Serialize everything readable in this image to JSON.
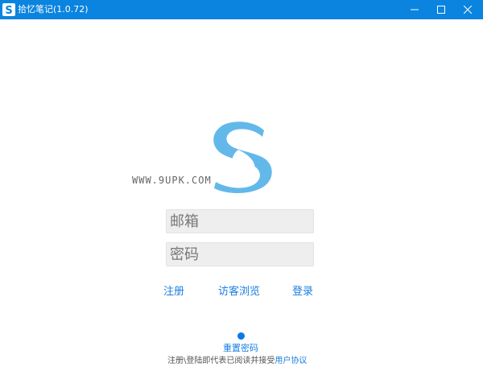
{
  "window": {
    "title": "拾忆笔记(1.0.72)",
    "app_icon_letter": "S",
    "titlebar_color": "#0a84df"
  },
  "logo": {
    "icon": "s-logo-icon",
    "color": "#63b8ea"
  },
  "watermark": "WWW.9UPK.COM",
  "form": {
    "email_placeholder": "邮箱",
    "password_placeholder": "密码"
  },
  "links": {
    "register": "注册",
    "guest_browse": "访客浏览",
    "login": "登录"
  },
  "footer": {
    "reset_password": "重置密码",
    "agreement_text": "注册\\登陆即代表已阅读并接受",
    "agreement_link": "用户协议"
  },
  "colors": {
    "link": "#1a7fe0",
    "dot": "#0a78e8"
  }
}
